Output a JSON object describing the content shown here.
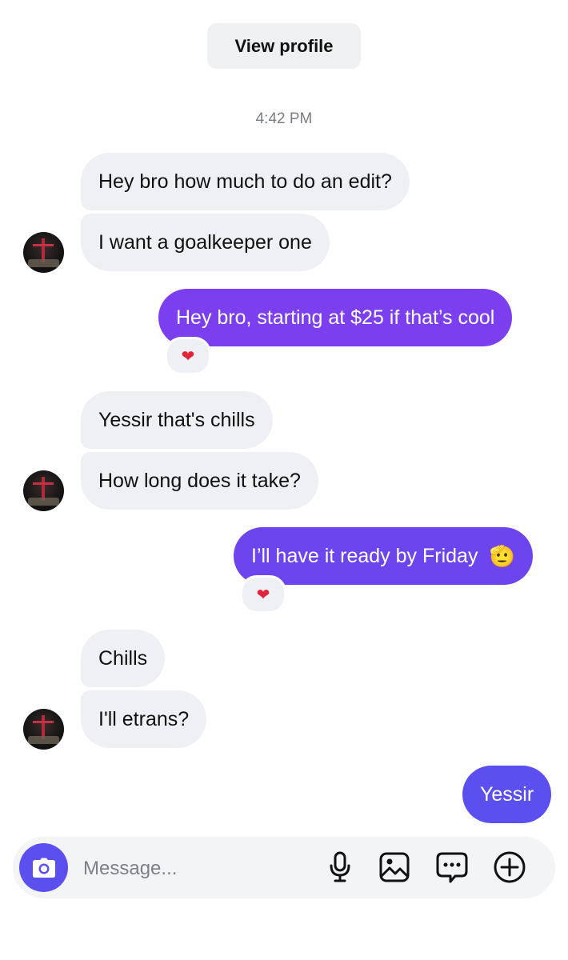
{
  "header": {
    "view_profile_label": "View profile"
  },
  "timestamp": "4:42 PM",
  "messages": [
    {
      "side": "in",
      "text": "Hey bro how much to do an edit?"
    },
    {
      "side": "in",
      "text": "I want a goalkeeper one"
    },
    {
      "side": "out",
      "text": "Hey bro, starting at $25 if that’s cool",
      "reaction": "❤"
    },
    {
      "side": "in",
      "text": "Yessir that's chills"
    },
    {
      "side": "in",
      "text": "How long does it take?"
    },
    {
      "side": "out",
      "text": "I’ll have it ready by Friday",
      "emoji": "🫡",
      "reaction": "❤"
    },
    {
      "side": "in",
      "text": "Chills"
    },
    {
      "side": "in",
      "text": "I'll etrans?"
    },
    {
      "side": "out",
      "text": "Yessir"
    }
  ],
  "composer": {
    "placeholder": "Message..."
  },
  "icons": {
    "camera": "camera-icon",
    "microphone": "microphone-icon",
    "gallery": "image-icon",
    "chat": "chat-bubble-icon",
    "add": "plus-circle-icon"
  },
  "colors": {
    "outgoing_1": "#7b3ff0",
    "outgoing_2": "#6c45ef",
    "outgoing_3": "#5b50ef",
    "incoming": "#eef0f3",
    "camera": "#5b4ff0",
    "heart": "#e0243a"
  }
}
